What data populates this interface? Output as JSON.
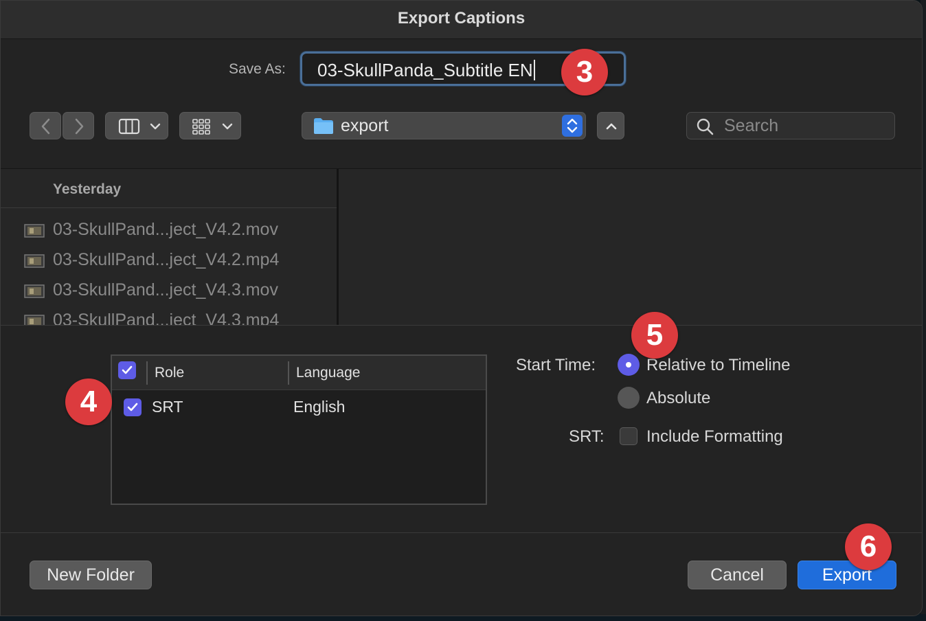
{
  "dialog": {
    "title": "Export Captions"
  },
  "save_as": {
    "label": "Save As:",
    "value": "03-SkullPanda_Subtitle EN"
  },
  "toolbar": {
    "back_icon": "chevron-left-icon",
    "forward_icon": "chevron-right-icon",
    "view_columns_icon": "columns-view-icon",
    "view_grid_icon": "icon-grid-view-icon",
    "location": "export",
    "search_placeholder": "Search"
  },
  "browser": {
    "section": "Yesterday",
    "files": [
      {
        "name": "03-SkullPand...ject_V4.2.mov"
      },
      {
        "name": "03-SkullPand...ject_V4.2.mp4"
      },
      {
        "name": "03-SkullPand...ject_V4.3.mov"
      },
      {
        "name": "03-SkullPand...ject_V4.3.mp4"
      }
    ]
  },
  "roles_table": {
    "headers": {
      "role": "Role",
      "language": "Language"
    },
    "rows": [
      {
        "checked": true,
        "role": "SRT",
        "language": "English"
      }
    ]
  },
  "options": {
    "start_time_label": "Start Time:",
    "relative": "Relative to Timeline",
    "absolute": "Absolute",
    "srt_label": "SRT:",
    "include_formatting": "Include Formatting"
  },
  "buttons": {
    "new_folder": "New Folder",
    "cancel": "Cancel",
    "export": "Export"
  },
  "callouts": {
    "c3": "3",
    "c4": "4",
    "c5": "5",
    "c6": "6"
  },
  "colors": {
    "accent": "#5e5ce6",
    "default_button": "#1f6ddb",
    "callout": "#dc3b3e",
    "focus_ring": "#4a6f98"
  }
}
